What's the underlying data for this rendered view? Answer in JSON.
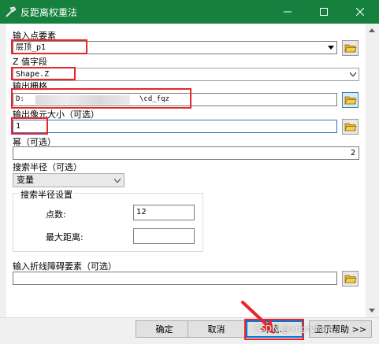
{
  "window": {
    "title": "反距离权重法",
    "accent_color": "#16813f"
  },
  "form": {
    "input_point_label": "输入点要素",
    "input_point_value": "层顶_p1",
    "z_field_label": "Z 值字段",
    "z_field_value": "Shape.Z",
    "output_raster_label": "输出栅格",
    "output_raster_prefix": "D:",
    "output_raster_suffix": "\\cd_fqz",
    "cell_size_label": "输出像元大小（可选）",
    "cell_size_value": "1",
    "power_label": "幂（可选）",
    "power_value": "2",
    "search_radius_label": "搜索半径（可选）",
    "search_radius_value": "变量",
    "search_radius_group_title": "搜索半径设置",
    "num_points_label": "点数:",
    "num_points_value": "12",
    "max_distance_label": "最大距离:",
    "max_distance_value": "",
    "barrier_label": "输入折线障碍要素（可选）",
    "barrier_value": ""
  },
  "buttons": {
    "ok": "确定",
    "cancel": "取消",
    "env": "环境...",
    "help": "显示帮助 >>"
  },
  "watermark": "CSDN @angryfcar",
  "annotation_color": "#e8252b"
}
